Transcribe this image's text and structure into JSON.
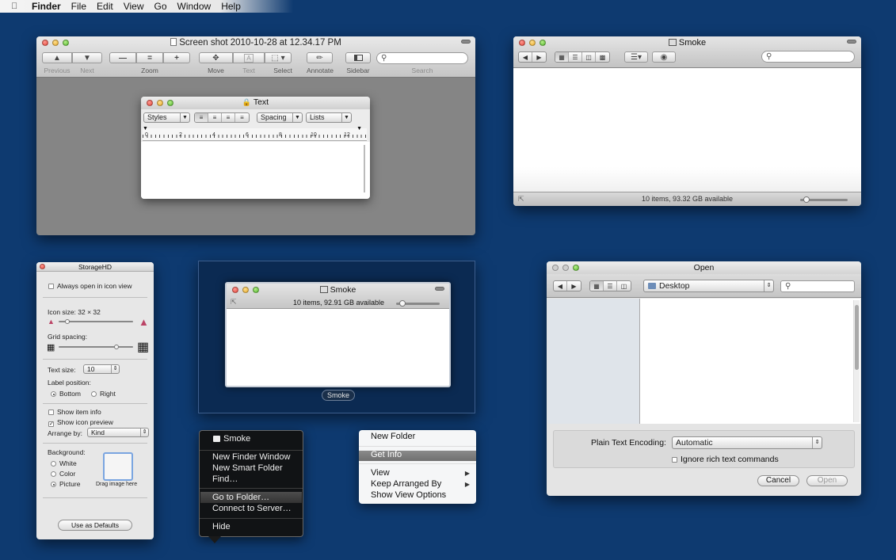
{
  "menubar": {
    "items": [
      "Finder",
      "File",
      "Edit",
      "View",
      "Go",
      "Window",
      "Help"
    ],
    "apple_icon": "apple-logo"
  },
  "preview": {
    "title": "Screen shot 2010-10-28 at 12.34.17 PM",
    "labels": {
      "previous": "Previous",
      "next": "Next",
      "zoom": "Zoom",
      "move": "Move",
      "text": "Text",
      "select": "Select",
      "annotate": "Annotate",
      "sidebar": "Sidebar",
      "search": "Search"
    }
  },
  "text_panel": {
    "title": "Text",
    "styles": "Styles",
    "spacing": "Spacing",
    "lists": "Lists",
    "ruler": [
      "0",
      "2",
      "4",
      "6",
      "8",
      "10",
      "12"
    ]
  },
  "smoke": {
    "title": "Smoke",
    "status": "10 items, 93.32 GB available"
  },
  "inspector": {
    "title": "StorageHD",
    "always_open": "Always open in icon view",
    "icon_size": "Icon size:  32 × 32",
    "grid_spacing": "Grid spacing:",
    "text_size_label": "Text size:",
    "text_size_value": "10",
    "label_position": "Label position:",
    "bottom": "Bottom",
    "right": "Right",
    "show_item_info": "Show item info",
    "show_icon_preview": "Show icon preview",
    "arrange_by_label": "Arrange by:",
    "arrange_by_value": "Kind",
    "background": "Background:",
    "white": "White",
    "color": "Color",
    "picture": "Picture",
    "drag_image": "Drag image here",
    "use_defaults": "Use as Defaults"
  },
  "space": {
    "window_title": "Smoke",
    "status": "10 items, 92.91 GB available",
    "label": "Smoke"
  },
  "dock_menu": {
    "header": "Smoke",
    "items": [
      "New Finder Window",
      "New Smart Folder",
      "Find…",
      "Go to Folder…",
      "Connect to Server…",
      "Hide"
    ]
  },
  "context_menu": {
    "items": [
      "New Folder",
      "Get Info",
      "View",
      "Keep Arranged By",
      "Show View Options"
    ]
  },
  "open_dialog": {
    "title": "Open",
    "location": "Desktop",
    "encoding_label": "Plain Text Encoding:",
    "encoding_value": "Automatic",
    "ignore_rich": "Ignore rich text commands",
    "cancel": "Cancel",
    "open": "Open"
  }
}
